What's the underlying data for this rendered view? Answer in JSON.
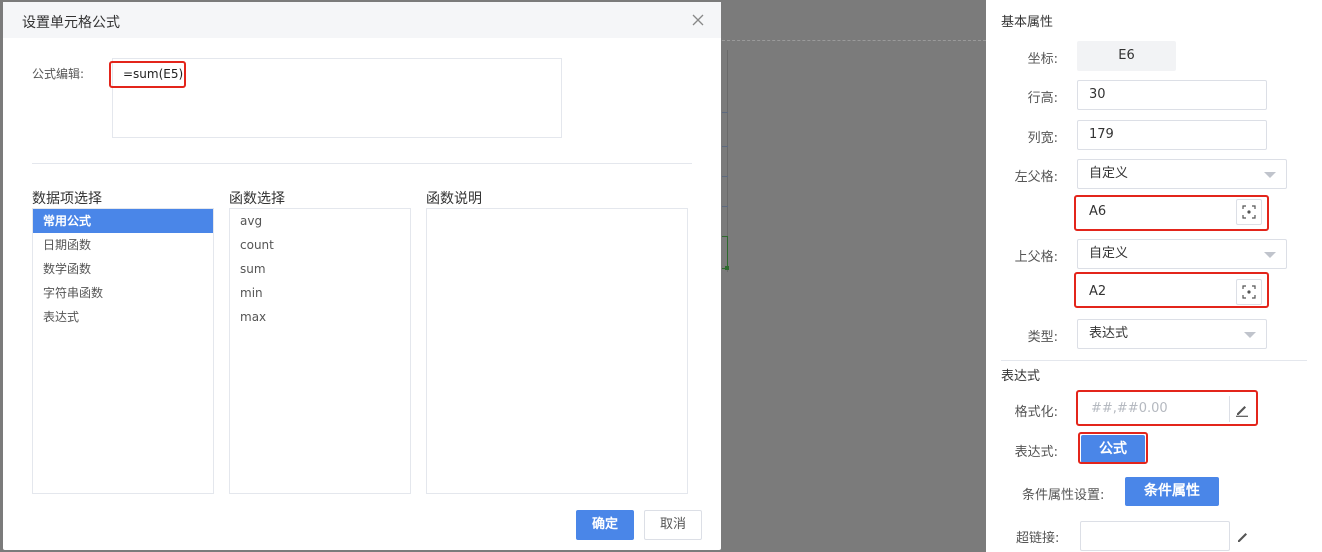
{
  "dialog": {
    "title": "设置单元格公式",
    "formula_label": "公式编辑:",
    "formula_value": "=sum(E5)",
    "columns": {
      "data_items_title": "数据项选择",
      "functions_title": "函数选择",
      "description_title": "函数说明"
    },
    "data_items": [
      "常用公式",
      "日期函数",
      "数学函数",
      "字符串函数",
      "表达式"
    ],
    "functions": [
      "avg",
      "count",
      "sum",
      "min",
      "max"
    ],
    "confirm_label": "确定",
    "cancel_label": "取消"
  },
  "panel": {
    "basic_section_title": "基本属性",
    "coord_label": "坐标:",
    "coord_value": "E6",
    "row_height_label": "行高:",
    "row_height_value": "30",
    "col_width_label": "列宽:",
    "col_width_value": "179",
    "left_parent_label": "左父格:",
    "left_parent_mode": "自定义",
    "left_parent_cell": "A6",
    "top_parent_label": "上父格:",
    "top_parent_mode": "自定义",
    "top_parent_cell": "A2",
    "type_label": "类型:",
    "type_value": "表达式",
    "expression_section_title": "表达式",
    "format_label": "格式化:",
    "format_placeholder": "##,##0.00",
    "expression_label": "表达式:",
    "formula_button": "公式",
    "condition_label": "条件属性设置:",
    "condition_button": "条件属性",
    "hyperlink_label": "超链接:",
    "hyperlink_value": ""
  },
  "colors": {
    "accent": "#4a86e8",
    "highlight": "#e3251b"
  },
  "icons": {
    "close": "close-icon",
    "pick_cell": "pick-cell-icon",
    "edit": "pencil-icon"
  }
}
